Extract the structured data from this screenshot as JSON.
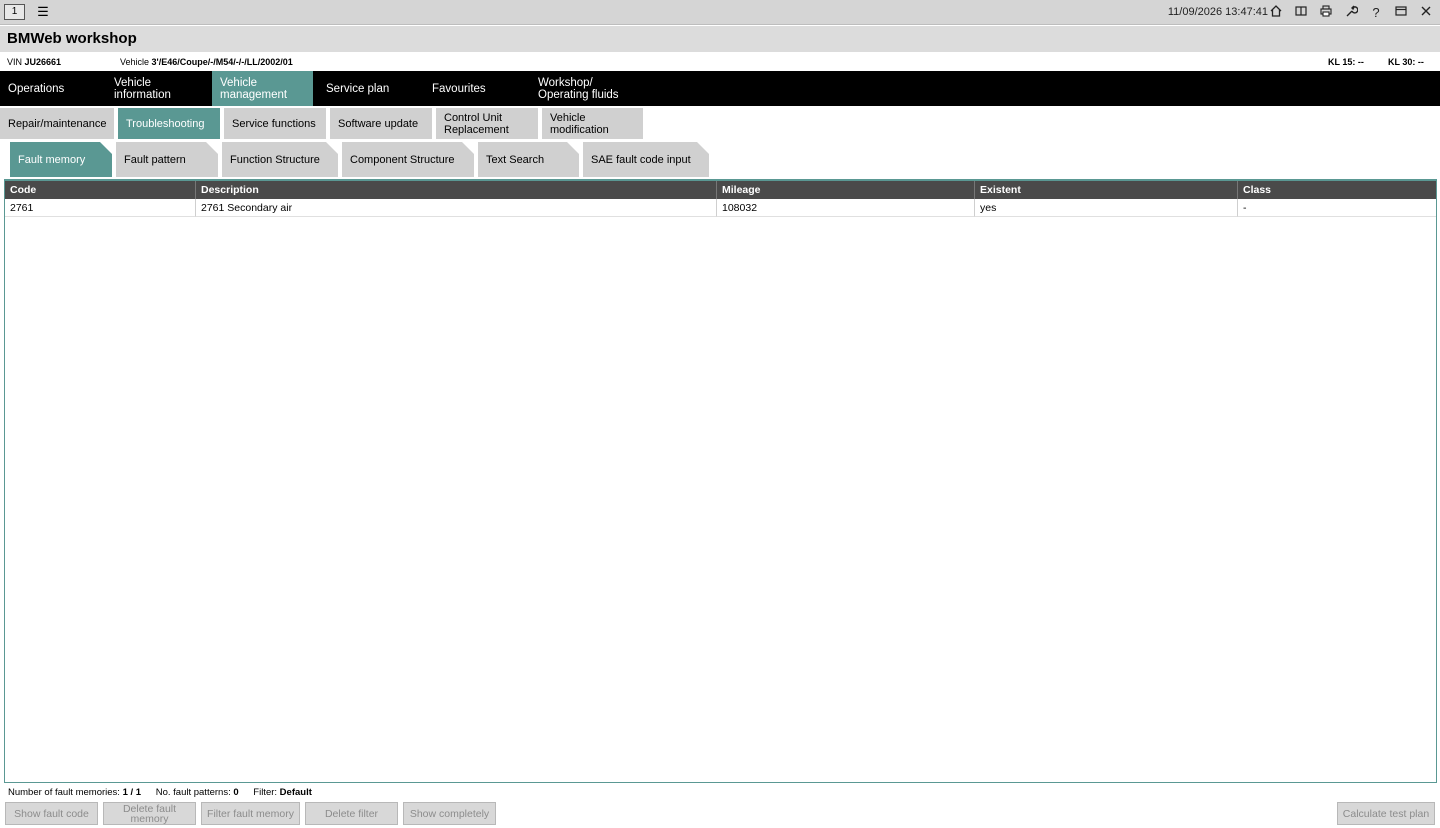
{
  "topbar": {
    "window_number": "1",
    "datetime": "11/09/2026 13:47:41",
    "icons": [
      "menu-icon",
      "home-icon",
      "split-view-icon",
      "print-icon",
      "wrench-icon",
      "help-icon",
      "window-icon",
      "close-icon"
    ]
  },
  "app": {
    "title": "BMWeb workshop"
  },
  "vehicle": {
    "vin_label": "VIN",
    "vin_value": "JU26661",
    "vehicle_label": "Vehicle",
    "vehicle_value": "3'/E46/Coupe/-/M54/-/-/LL/2002/01",
    "kl15": "KL 15:  --",
    "kl30": "KL 30:  --"
  },
  "main_nav": [
    {
      "label": "Operations"
    },
    {
      "label": "Vehicle information"
    },
    {
      "label": "Vehicle management"
    },
    {
      "label": "Service plan"
    },
    {
      "label": "Favourites"
    },
    {
      "label": "Workshop/ Operating fluids"
    }
  ],
  "sub_nav": [
    {
      "label": "Repair/maintenance"
    },
    {
      "label": "Troubleshooting"
    },
    {
      "label": "Service functions"
    },
    {
      "label": "Software update"
    },
    {
      "label": "Control Unit Replacement"
    },
    {
      "label": "Vehicle modification"
    }
  ],
  "tabs": [
    {
      "label": "Fault memory"
    },
    {
      "label": "Fault pattern"
    },
    {
      "label": "Function Structure"
    },
    {
      "label": "Component Structure"
    },
    {
      "label": "Text Search"
    },
    {
      "label": "SAE fault code input"
    }
  ],
  "table": {
    "columns": [
      "Code",
      "Description",
      "Mileage",
      "Existent",
      "Class"
    ],
    "rows": [
      [
        "2761",
        "2761 Secondary air",
        "108032",
        "yes",
        "-"
      ]
    ]
  },
  "status": {
    "fault_memories_label": "Number of fault memories:",
    "fault_memories_value": "1 / 1",
    "fault_patterns_label": "No. fault patterns:",
    "fault_patterns_value": "0",
    "filter_label": "Filter:",
    "filter_value": "Default"
  },
  "buttons": {
    "show_fault_code": "Show fault code",
    "delete_fault_memory": "Delete fault memory",
    "filter_fault_memory": "Filter fault memory",
    "delete_filter": "Delete filter",
    "show_completely": "Show completely",
    "calculate_test_plan": "Calculate test plan"
  },
  "colors": {
    "accent": "#5a9893",
    "nav_bg": "#000000",
    "header_bg": "#4a4a4a",
    "disabled_text": "#8c8c8c"
  }
}
